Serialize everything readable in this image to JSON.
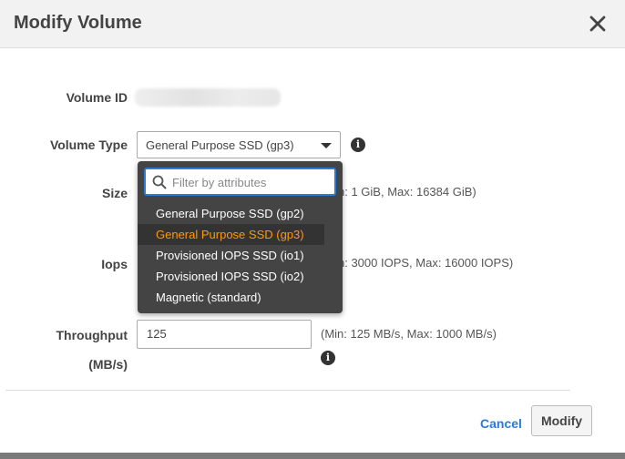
{
  "modal": {
    "title": "Modify Volume",
    "close_icon": "close-icon"
  },
  "form": {
    "volume_id": {
      "label": "Volume ID"
    },
    "volume_type": {
      "label": "Volume Type",
      "value": "General Purpose SSD (gp3)",
      "info_icon": "info-icon"
    },
    "size": {
      "label": "Size",
      "hint_visible": "n: 1 GiB, Max: 16384 GiB)"
    },
    "iops": {
      "label": "Iops",
      "hint_visible": "n: 3000 IOPS, Max: 16000 IOPS)"
    },
    "throughput": {
      "label_line1": "Throughput",
      "label_line2": "(MB/s)",
      "value": "125",
      "hint": "(Min: 125 MB/s, Max: 1000 MB/s)",
      "info_icon": "info-icon"
    }
  },
  "dropdown": {
    "filter_placeholder": "Filter by attributes",
    "search_icon": "search-icon",
    "options": [
      {
        "label": "General Purpose SSD (gp2)",
        "selected": false
      },
      {
        "label": "General Purpose SSD (gp3)",
        "selected": true
      },
      {
        "label": "Provisioned IOPS SSD (io1)",
        "selected": false
      },
      {
        "label": "Provisioned IOPS SSD (io2)",
        "selected": false
      },
      {
        "label": "Magnetic (standard)",
        "selected": false
      }
    ]
  },
  "footer": {
    "cancel_label": "Cancel",
    "modify_label": "Modify"
  },
  "colors": {
    "accent_blue": "#2a7bd6",
    "selected_option": "#ff9900",
    "dropdown_bg": "#444444"
  }
}
